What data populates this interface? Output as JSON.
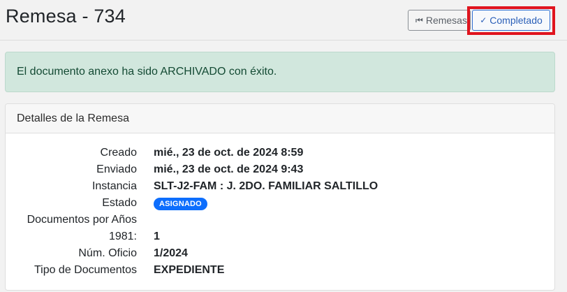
{
  "header": {
    "title": "Remesa - 734",
    "remesas_button": {
      "icon": "skip-back-icon",
      "label": "Remesas"
    },
    "completado_button": {
      "icon": "check-icon",
      "label": "Completado"
    }
  },
  "alert": {
    "message": "El documento anexo ha sido ARCHIVADO con éxito."
  },
  "card": {
    "title": "Detalles de la Remesa",
    "fields": [
      {
        "label": "Creado",
        "value": "mié., 23 de oct. de 2024 8:59"
      },
      {
        "label": "Enviado",
        "value": "mié., 23 de oct. de 2024 9:43"
      },
      {
        "label": "Instancia",
        "value": "SLT-J2-FAM : J. 2DO. FAMILIAR SALTILLO"
      },
      {
        "label": "Estado",
        "value": "ASIGNADO"
      },
      {
        "label": "Documentos por Años",
        "value": ""
      },
      {
        "label": "1981:",
        "value": "1"
      },
      {
        "label": "Núm. Oficio",
        "value": "1/2024"
      },
      {
        "label": "Tipo de Documentos",
        "value": "EXPEDIENTE"
      }
    ]
  },
  "colors": {
    "alert_bg": "#d1e7dd",
    "badge_bg": "#0d6efd",
    "highlight": "#e0141e",
    "primary_outline": "#2f6fd1"
  }
}
